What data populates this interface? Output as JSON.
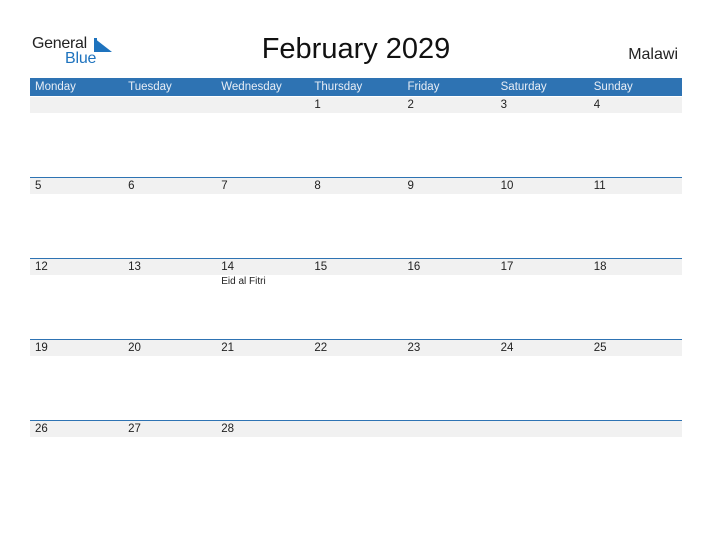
{
  "logo": {
    "line1": "General",
    "line2": "Blue",
    "accent_color": "#1e73be"
  },
  "title": "February 2029",
  "country": "Malawi",
  "colors": {
    "header_bg": "#2e73b3",
    "date_band": "#f1f1f1"
  },
  "weekdays": [
    "Monday",
    "Tuesday",
    "Wednesday",
    "Thursday",
    "Friday",
    "Saturday",
    "Sunday"
  ],
  "weeks": [
    {
      "days": [
        {
          "num": "",
          "event": ""
        },
        {
          "num": "",
          "event": ""
        },
        {
          "num": "",
          "event": ""
        },
        {
          "num": "1",
          "event": ""
        },
        {
          "num": "2",
          "event": ""
        },
        {
          "num": "3",
          "event": ""
        },
        {
          "num": "4",
          "event": ""
        }
      ]
    },
    {
      "days": [
        {
          "num": "5",
          "event": ""
        },
        {
          "num": "6",
          "event": ""
        },
        {
          "num": "7",
          "event": ""
        },
        {
          "num": "8",
          "event": ""
        },
        {
          "num": "9",
          "event": ""
        },
        {
          "num": "10",
          "event": ""
        },
        {
          "num": "11",
          "event": ""
        }
      ]
    },
    {
      "days": [
        {
          "num": "12",
          "event": ""
        },
        {
          "num": "13",
          "event": ""
        },
        {
          "num": "14",
          "event": "Eid al Fitri"
        },
        {
          "num": "15",
          "event": ""
        },
        {
          "num": "16",
          "event": ""
        },
        {
          "num": "17",
          "event": ""
        },
        {
          "num": "18",
          "event": ""
        }
      ]
    },
    {
      "days": [
        {
          "num": "19",
          "event": ""
        },
        {
          "num": "20",
          "event": ""
        },
        {
          "num": "21",
          "event": ""
        },
        {
          "num": "22",
          "event": ""
        },
        {
          "num": "23",
          "event": ""
        },
        {
          "num": "24",
          "event": ""
        },
        {
          "num": "25",
          "event": ""
        }
      ]
    },
    {
      "days": [
        {
          "num": "26",
          "event": ""
        },
        {
          "num": "27",
          "event": ""
        },
        {
          "num": "28",
          "event": ""
        },
        {
          "num": "",
          "event": ""
        },
        {
          "num": "",
          "event": ""
        },
        {
          "num": "",
          "event": ""
        },
        {
          "num": "",
          "event": ""
        }
      ]
    }
  ]
}
